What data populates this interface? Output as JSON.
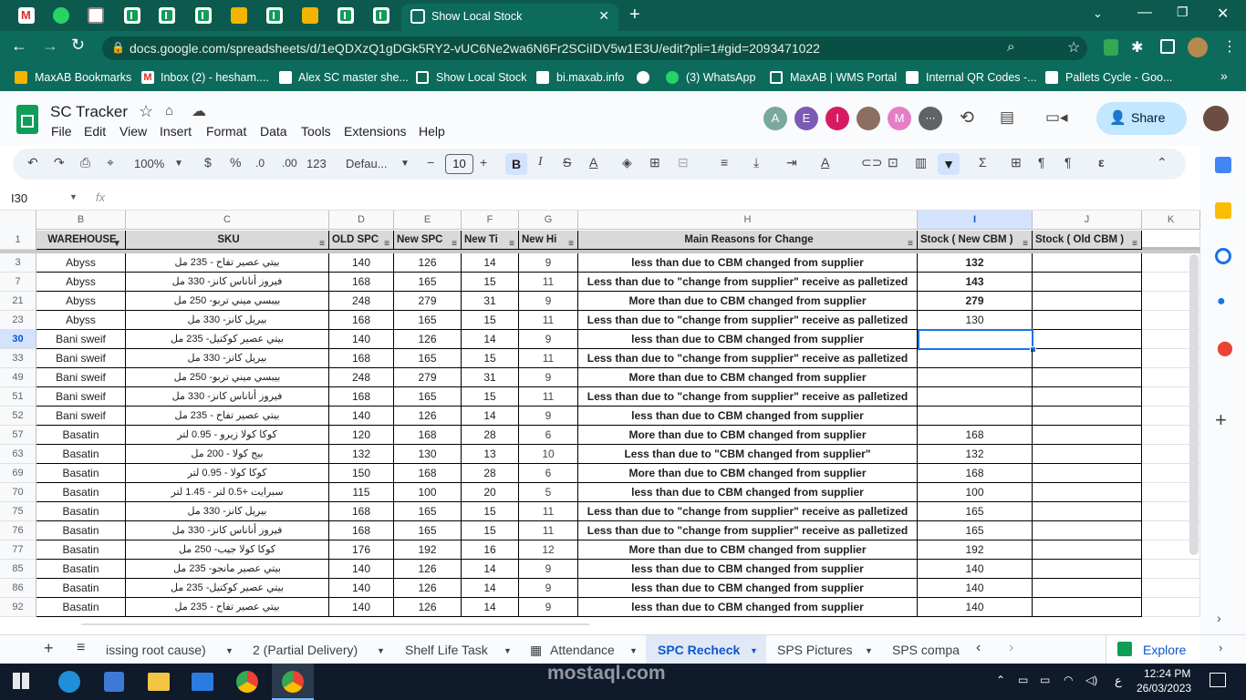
{
  "browser": {
    "active_tab_title": "Show Local Stock",
    "url": "docs.google.com/spreadsheets/d/1eQDXzQ1gDGk5RY2-vUC6Ne2wa6N6Fr2SCiIDV5w1E3U/edit?pli=1#gid=2093471022",
    "bookmarks": [
      "MaxAB Bookmarks",
      "Inbox (2) - hesham....",
      "Alex SC master she...",
      "Show Local Stock",
      "bi.maxab.info",
      "(3) WhatsApp",
      "MaxAB | WMS Portal",
      "Internal QR Codes -...",
      "Pallets Cycle - Goo..."
    ]
  },
  "app": {
    "doc_title": "SC Tracker",
    "menus": [
      "File",
      "Edit",
      "View",
      "Insert",
      "Format",
      "Data",
      "Tools",
      "Extensions",
      "Help"
    ],
    "share_label": "Share",
    "avatars": [
      "A",
      "E",
      "I",
      "M"
    ],
    "avatar_colors": [
      "#7aa89b",
      "#7b5bb6",
      "#d81b60",
      "#e67ec7"
    ]
  },
  "toolbar": {
    "zoom": "100%",
    "currency": "$",
    "percent": "%",
    "dec_less": ".0",
    "dec_more": ".00",
    "number_format": "123",
    "font": "Defau...",
    "font_size": "10"
  },
  "formula": {
    "cell_ref": "I30",
    "fx": "fx"
  },
  "grid": {
    "column_letters": [
      "B",
      "C",
      "D",
      "E",
      "F",
      "G",
      "H",
      "I",
      "J",
      "K"
    ],
    "headers": [
      "WAREHOUSE",
      "SKU",
      "OLD SPC",
      "New SPC",
      "New Ti",
      "New Hi",
      "Main Reasons for Change",
      "Stock ( New CBM )",
      "Stock ( Old CBM )"
    ],
    "rows": [
      {
        "num": "3",
        "wh": "Abyss",
        "sku": "بيتي عصير تفاح - 235 مل",
        "old": "140",
        "new": "126",
        "ti": "14",
        "hi": "9",
        "reason": "less than due to CBM changed from supplier",
        "stock": "132",
        "bold": true
      },
      {
        "num": "7",
        "wh": "Abyss",
        "sku": "فيروز أناناس كانز- 330 مل",
        "old": "168",
        "new": "165",
        "ti": "15",
        "hi": "11",
        "reason": "Less than due to \"change from supplier\" receive as palletized",
        "stock": "143",
        "bold": true
      },
      {
        "num": "21",
        "wh": "Abyss",
        "sku": "بيبسي ميني تربو- 250 مل",
        "old": "248",
        "new": "279",
        "ti": "31",
        "hi": "9",
        "reason": "More than due to CBM changed from supplier",
        "stock": "279",
        "bold": true
      },
      {
        "num": "23",
        "wh": "Abyss",
        "sku": "بيريل كانز- 330 مل",
        "old": "168",
        "new": "165",
        "ti": "15",
        "hi": "11",
        "reason": "Less than due to \"change from supplier\" receive as palletized",
        "stock": "130",
        "bold": false
      },
      {
        "num": "30",
        "wh": "Bani sweif",
        "sku": "بيتي عصير كوكتيل- 235 مل",
        "old": "140",
        "new": "126",
        "ti": "14",
        "hi": "9",
        "reason": "less than due to CBM changed from supplier",
        "stock": "",
        "bold": false
      },
      {
        "num": "33",
        "wh": "Bani sweif",
        "sku": "بيريل كانز- 330 مل",
        "old": "168",
        "new": "165",
        "ti": "15",
        "hi": "11",
        "reason": "Less than due to \"change from supplier\" receive as palletized",
        "stock": "",
        "bold": false
      },
      {
        "num": "49",
        "wh": "Bani sweif",
        "sku": "بيبسي ميني تربو- 250 مل",
        "old": "248",
        "new": "279",
        "ti": "31",
        "hi": "9",
        "reason": "More than due to CBM changed from supplier",
        "stock": "",
        "bold": false
      },
      {
        "num": "51",
        "wh": "Bani sweif",
        "sku": "فيروز أناناس كانز- 330 مل",
        "old": "168",
        "new": "165",
        "ti": "15",
        "hi": "11",
        "reason": "Less than due to \"change from supplier\" receive as palletized",
        "stock": "",
        "bold": false
      },
      {
        "num": "52",
        "wh": "Bani sweif",
        "sku": "بيتي عصير تفاح - 235 مل",
        "old": "140",
        "new": "126",
        "ti": "14",
        "hi": "9",
        "reason": "less than due to CBM changed from supplier",
        "stock": "",
        "bold": false
      },
      {
        "num": "57",
        "wh": "Basatin",
        "sku": "كوكا كولا زيرو - 0.95 لتر",
        "old": "120",
        "new": "168",
        "ti": "28",
        "hi": "6",
        "reason": "More than due to CBM changed from supplier",
        "stock": "168",
        "bold": false
      },
      {
        "num": "63",
        "wh": "Basatin",
        "sku": "بيج كولا - 200 مل",
        "old": "132",
        "new": "130",
        "ti": "13",
        "hi": "10",
        "reason": "Less than due to \"CBM changed from supplier\"",
        "stock": "132",
        "bold": false
      },
      {
        "num": "69",
        "wh": "Basatin",
        "sku": "كوكا كولا - 0.95 لتر",
        "old": "150",
        "new": "168",
        "ti": "28",
        "hi": "6",
        "reason": "More than due to CBM changed from supplier",
        "stock": "168",
        "bold": false
      },
      {
        "num": "70",
        "wh": "Basatin",
        "sku": "سبرايت +0.5 لتر - 1.45 لتر",
        "old": "115",
        "new": "100",
        "ti": "20",
        "hi": "5",
        "reason": "less than due to CBM changed from supplier",
        "stock": "100",
        "bold": false
      },
      {
        "num": "75",
        "wh": "Basatin",
        "sku": "بيريل كانز- 330 مل",
        "old": "168",
        "new": "165",
        "ti": "15",
        "hi": "11",
        "reason": "Less than due to \"change from supplier\" receive as palletized",
        "stock": "165",
        "bold": false
      },
      {
        "num": "76",
        "wh": "Basatin",
        "sku": "فيروز أناناس كانز- 330 مل",
        "old": "168",
        "new": "165",
        "ti": "15",
        "hi": "11",
        "reason": "Less than due to \"change from supplier\" receive as palletized",
        "stock": "165",
        "bold": false
      },
      {
        "num": "77",
        "wh": "Basatin",
        "sku": "كوكا كولا جيب- 250 مل",
        "old": "176",
        "new": "192",
        "ti": "16",
        "hi": "12",
        "reason": "More than due to CBM changed from supplier",
        "stock": "192",
        "bold": false
      },
      {
        "num": "85",
        "wh": "Basatin",
        "sku": "بيتي عصير مانجو- 235 مل",
        "old": "140",
        "new": "126",
        "ti": "14",
        "hi": "9",
        "reason": "less than due to CBM changed from supplier",
        "stock": "140",
        "bold": false
      },
      {
        "num": "86",
        "wh": "Basatin",
        "sku": "بيتي عصير كوكتيل- 235 مل",
        "old": "140",
        "new": "126",
        "ti": "14",
        "hi": "9",
        "reason": "less than due to CBM changed from supplier",
        "stock": "140",
        "bold": false
      },
      {
        "num": "92",
        "wh": "Basatin",
        "sku": "بيتي عصير تفاح - 235 مل",
        "old": "140",
        "new": "126",
        "ti": "14",
        "hi": "9",
        "reason": "less than due to CBM changed from supplier",
        "stock": "140",
        "bold": false
      }
    ]
  },
  "sheet_tabs": [
    "issing root cause)",
    "2 (Partial Delivery)",
    "Shelf Life Task",
    "Attendance",
    "SPC Recheck",
    "SPS Pictures",
    "SPS compa"
  ],
  "active_sheet": "SPC Recheck",
  "explore_label": "Explore",
  "taskbar": {
    "time": "12:24 PM",
    "date": "26/03/2023",
    "lang": "ع"
  },
  "watermark": "mostaql.com"
}
